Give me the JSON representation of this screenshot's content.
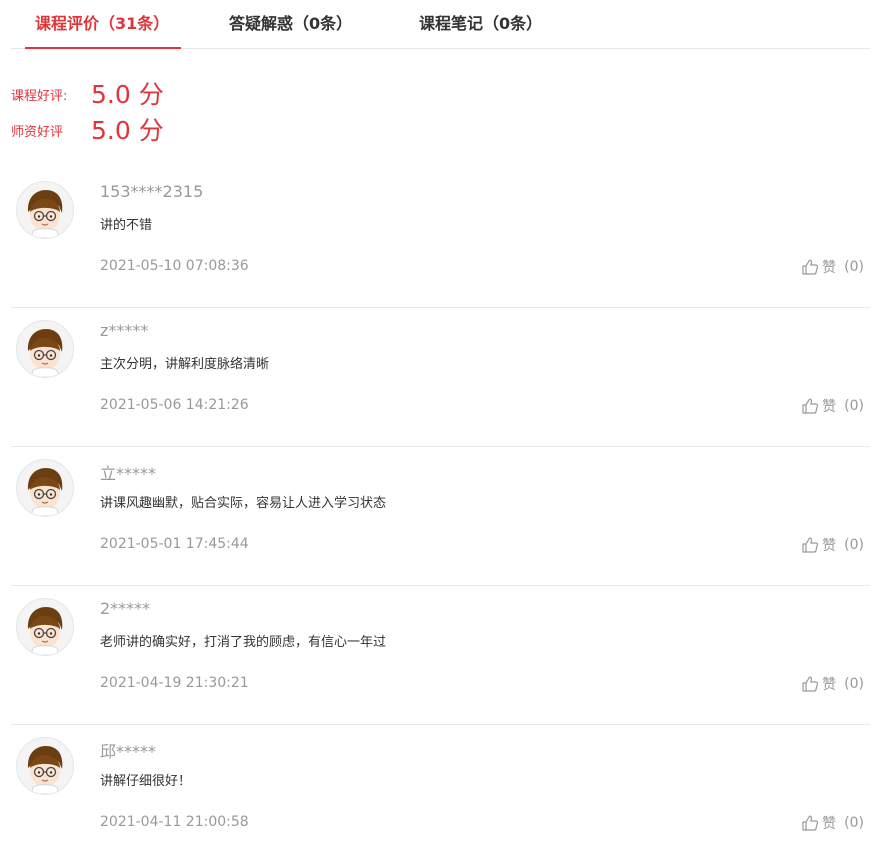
{
  "tabs": [
    {
      "label": "课程评价（31条）"
    },
    {
      "label": "答疑解惑（0条）"
    },
    {
      "label": "课程笔记（0条）"
    }
  ],
  "ratings": {
    "course_label": "课程好评:",
    "course_value": "5.0 分",
    "teacher_label": "师资好评",
    "teacher_value": "5.0 分"
  },
  "comments": [
    {
      "user": "153****2315",
      "text": "讲的不错",
      "time": "2021-05-10 07:08:36",
      "like_label": "赞",
      "like_count": "(0)"
    },
    {
      "user": "z*****",
      "text": "主次分明，讲解利度脉络清晰",
      "time": "2021-05-06 14:21:26",
      "like_label": "赞",
      "like_count": "(0)"
    },
    {
      "user": "立*****",
      "text": "讲课风趣幽默，贴合实际，容易让人进入学习状态",
      "time": "2021-05-01 17:45:44",
      "like_label": "赞",
      "like_count": "(0)"
    },
    {
      "user": "2*****",
      "text": "老师讲的确实好，打消了我的顾虑，有信心一年过",
      "time": "2021-04-19 21:30:21",
      "like_label": "赞",
      "like_count": "(0)"
    },
    {
      "user": "邱*****",
      "text": "讲解仔细很好！",
      "time": "2021-04-11 21:00:58",
      "like_label": "赞",
      "like_count": "(0)"
    }
  ],
  "colors": {
    "accent": "#e0353b",
    "muted": "#999999",
    "divider": "#e8e8e8"
  },
  "icons": {
    "like": "thumbs-up-icon",
    "avatar": "cartoon-boy-avatar"
  }
}
